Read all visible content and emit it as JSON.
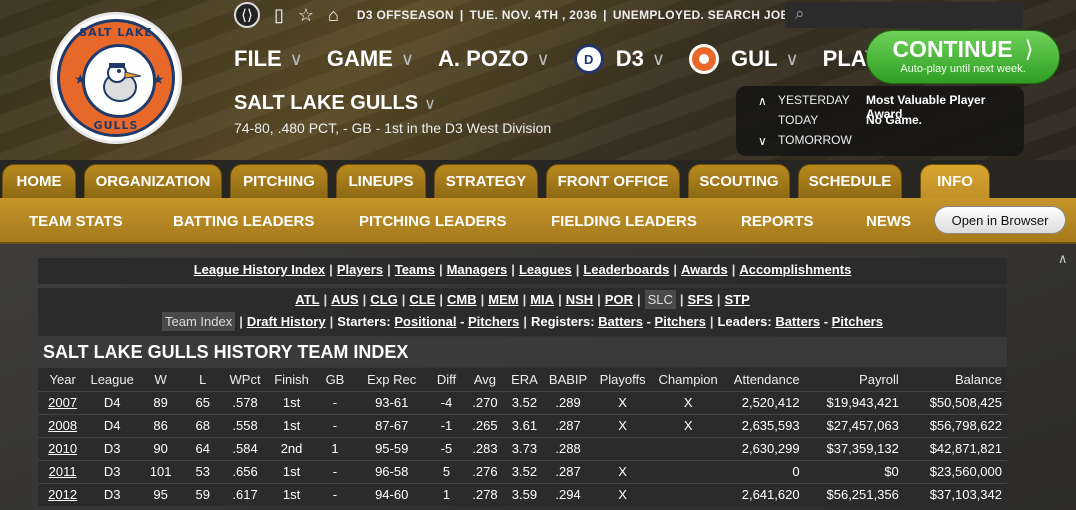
{
  "topbar": {
    "status_season": "D3 OFFSEASON",
    "status_date": "TUE. NOV. 4TH , 2036",
    "status_job": "UNEMPLOYED. SEARCH JOBS..."
  },
  "logo": {
    "top_text": "SALT LAKE",
    "bottom_text": "GULLS"
  },
  "menu": {
    "file": "FILE",
    "game": "GAME",
    "manager": "A. POZO",
    "league": "D3",
    "team": "GUL",
    "play": "PLAY"
  },
  "continue": {
    "label": "CONTINUE",
    "sub": "Auto-play until next week."
  },
  "team": {
    "name": "SALT LAKE GULLS",
    "record": "74-80, .480 PCT, - GB - 1st in the D3 West Division"
  },
  "schedule": {
    "yesterday_label": "YESTERDAY",
    "yesterday_value": "Most Valuable Player Award",
    "today_label": "TODAY",
    "today_value": "No Game.",
    "tomorrow_label": "TOMORROW"
  },
  "tabs": [
    "HOME",
    "ORGANIZATION",
    "PITCHING",
    "LINEUPS",
    "STRATEGY",
    "FRONT OFFICE",
    "SCOUTING",
    "SCHEDULE",
    "INFO"
  ],
  "subnav": {
    "items": [
      "TEAM STATS",
      "BATTING LEADERS",
      "PITCHING LEADERS",
      "FIELDING LEADERS",
      "REPORTS",
      "NEWS"
    ],
    "open_browser": "Open in Browser"
  },
  "links_row1": [
    "League History Index",
    "Players",
    "Teams",
    "Managers",
    "Leagues",
    "Leaderboards",
    "Awards",
    "Accomplishments"
  ],
  "links_row2": [
    "ATL",
    "AUS",
    "CLG",
    "CLE",
    "CMB",
    "MEM",
    "MIA",
    "NSH",
    "POR",
    "SLC",
    "SFS",
    "STP"
  ],
  "links_row3": {
    "team_index": "Team Index",
    "draft_history": "Draft History",
    "starters_label": "Starters:",
    "positional": "Positional",
    "pitchers1": "Pitchers",
    "registers_label": "Registers:",
    "batters1": "Batters",
    "pitchers2": "Pitchers",
    "leaders_label": "Leaders:",
    "batters2": "Batters",
    "pitchers3": "Pitchers"
  },
  "history": {
    "title": "SALT LAKE GULLS HISTORY TEAM INDEX",
    "columns": [
      "Year",
      "League",
      "W",
      "L",
      "WPct",
      "Finish",
      "GB",
      "Exp Rec",
      "Diff",
      "Avg",
      "ERA",
      "BABIP",
      "Playoffs",
      "Champion",
      "Attendance",
      "Payroll",
      "Balance"
    ],
    "rows": [
      [
        "2007",
        "D4",
        "89",
        "65",
        ".578",
        "1st",
        "-",
        "93-61",
        "-4",
        ".270",
        "3.52",
        ".289",
        "X",
        "X",
        "2,520,412",
        "$19,943,421",
        "$50,508,425"
      ],
      [
        "2008",
        "D4",
        "86",
        "68",
        ".558",
        "1st",
        "-",
        "87-67",
        "-1",
        ".265",
        "3.61",
        ".287",
        "X",
        "X",
        "2,635,593",
        "$27,457,063",
        "$56,798,622"
      ],
      [
        "2010",
        "D3",
        "90",
        "64",
        ".584",
        "2nd",
        "1",
        "95-59",
        "-5",
        ".283",
        "3.73",
        ".288",
        "",
        "",
        "2,630,299",
        "$37,359,132",
        "$42,871,821"
      ],
      [
        "2011",
        "D3",
        "101",
        "53",
        ".656",
        "1st",
        "-",
        "96-58",
        "5",
        ".276",
        "3.52",
        ".287",
        "X",
        "",
        "0",
        "$0",
        "$23,560,000"
      ],
      [
        "2012",
        "D3",
        "95",
        "59",
        ".617",
        "1st",
        "-",
        "94-60",
        "1",
        ".278",
        "3.59",
        ".294",
        "X",
        "",
        "2,641,620",
        "$56,251,356",
        "$37,103,342"
      ]
    ]
  }
}
